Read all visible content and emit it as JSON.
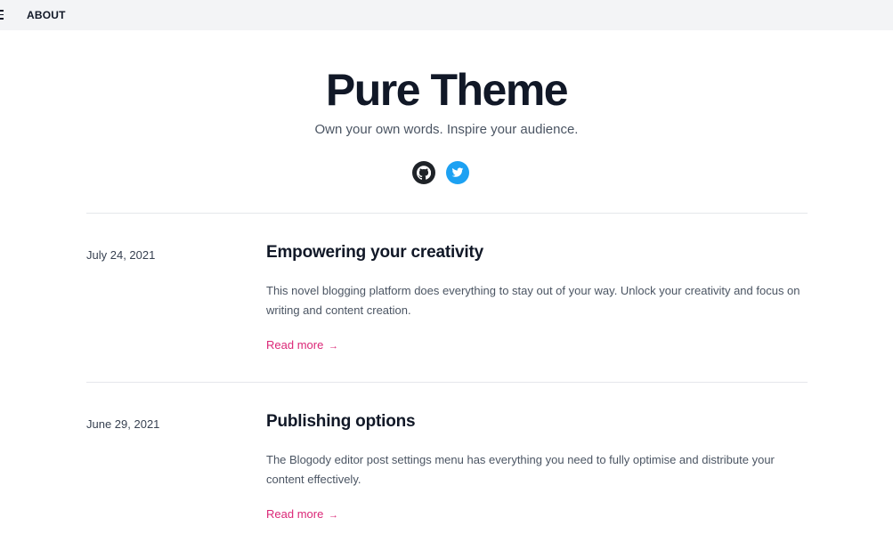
{
  "nav": {
    "about_label": "ABOUT"
  },
  "hero": {
    "title": "Pure Theme",
    "subtitle": "Own your own words. Inspire your audience."
  },
  "social": {
    "icons": [
      "github-icon",
      "twitter-icon"
    ],
    "colors": {
      "github": "#1f2328",
      "twitter": "#1da1f2"
    }
  },
  "accent_color": "#db2777",
  "posts": [
    {
      "date": "July 24, 2021",
      "title": "Empowering your creativity",
      "excerpt": "This novel blogging platform does everything to stay out of your way. Unlock your creativity and focus on writing and content creation.",
      "read_more": "Read more",
      "arrow": "→"
    },
    {
      "date": "June 29, 2021",
      "title": "Publishing options",
      "excerpt": "The Blogody editor post settings menu has everything you need to fully optimise and distribute your content effectively.",
      "read_more": "Read more",
      "arrow": "→"
    }
  ]
}
